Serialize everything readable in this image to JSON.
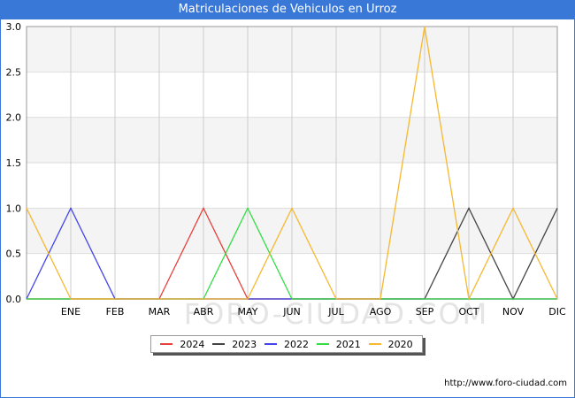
{
  "chart_data": {
    "type": "line",
    "title": "Matriculaciones de Vehiculos en Urroz",
    "x": [
      "",
      "ENE",
      "FEB",
      "MAR",
      "ABR",
      "MAY",
      "JUN",
      "JUL",
      "AGO",
      "SEP",
      "OCT",
      "NOV",
      "DIC"
    ],
    "ylim": [
      0,
      3.0
    ],
    "yticks": [
      "0.0",
      "0.5",
      "1.0",
      "1.5",
      "2.0",
      "2.5",
      "3.0"
    ],
    "grid": true,
    "legend_position": "bottom",
    "series": [
      {
        "name": "2024",
        "color": "#e8403c",
        "values": [
          0,
          0,
          0,
          0,
          1,
          0,
          0,
          0,
          0,
          0,
          0,
          0,
          0
        ]
      },
      {
        "name": "2023",
        "color": "#444444",
        "values": [
          0,
          0,
          0,
          0,
          0,
          0,
          0,
          0,
          0,
          0,
          1,
          0,
          1
        ]
      },
      {
        "name": "2022",
        "color": "#4444ee",
        "values": [
          0,
          1,
          0,
          0,
          0,
          0,
          0,
          0,
          0,
          0,
          0,
          0,
          0
        ]
      },
      {
        "name": "2021",
        "color": "#33dd44",
        "values": [
          0,
          0,
          0,
          0,
          0,
          1,
          0,
          0,
          0,
          0,
          0,
          0,
          0
        ]
      },
      {
        "name": "2020",
        "color": "#f5b830",
        "values": [
          1,
          0,
          0,
          0,
          0,
          0,
          1,
          0,
          0,
          3,
          0,
          1,
          0
        ]
      }
    ]
  },
  "watermark": "FORO-CIUDAD.COM",
  "source_url": "http://www.foro-ciudad.com"
}
